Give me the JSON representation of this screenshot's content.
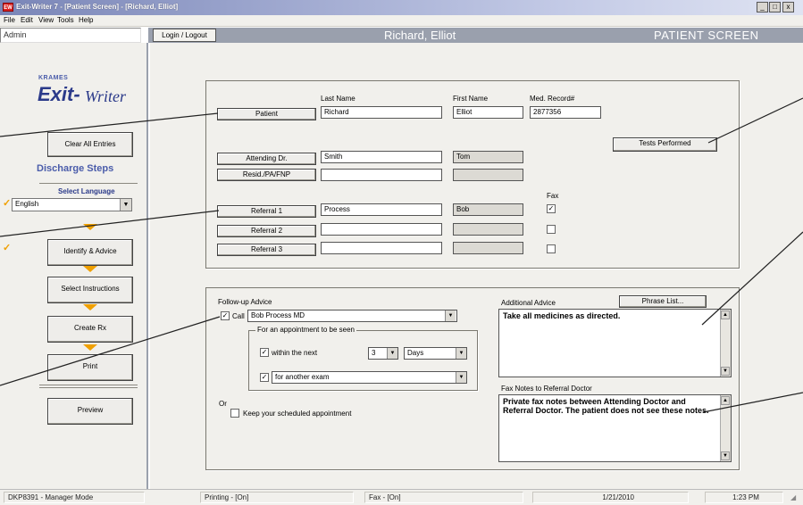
{
  "window": {
    "icon_text": "EW",
    "title": "Exit-Writer 7 - [Patient Screen] - [Richard, Elliot]",
    "minimize": "_",
    "maximize": "□",
    "close": "x"
  },
  "menu": [
    "File",
    "Edit",
    "View",
    "Tools",
    "Help"
  ],
  "header": {
    "user": "Admin",
    "login_label": "Login / Logout",
    "patient_name": "Richard, Elliot",
    "screen_title": "PATIENT SCREEN"
  },
  "sidebar": {
    "logo_brand": "KRAMES",
    "logo_exit": "Exit-",
    "logo_writer": "Writer",
    "clear_all": "Clear All Entries",
    "discharge_steps": "Discharge Steps",
    "select_language": "Select Language",
    "language": "English",
    "identify": "Identify & Advice",
    "select_instructions": "Select Instructions",
    "create_rx": "Create Rx",
    "print": "Print",
    "preview": "Preview"
  },
  "patient": {
    "last_name_label": "Last Name",
    "first_name_label": "First Name",
    "mrn_label": "Med. Record#",
    "patient_button": "Patient",
    "last_name": "Richard",
    "first_name": "Elliot",
    "mrn": "2877356",
    "tests_button": "Tests Performed",
    "attending_button": "Attending Dr.",
    "attending_last": "Smith",
    "attending_first": "Tom",
    "resid_button": "Resid./PA/FNP",
    "fax_label": "Fax",
    "referral1_button": "Referral 1",
    "referral1_last": "Process",
    "referral1_first": "Bob",
    "referral1_fax": "✓",
    "referral2_button": "Referral 2",
    "referral3_button": "Referral 3"
  },
  "followup": {
    "label": "Follow-up Advice",
    "call_checked": "✓",
    "call_label": "Call",
    "call_value": "Bob Process MD",
    "appointment_group": "For an appointment to be seen",
    "within_checked": "✓",
    "within_label": "within the next",
    "within_number": "3",
    "within_unit": "Days",
    "another_checked": "✓",
    "another_value": "for another exam",
    "or_label": "Or",
    "keep_label": "Keep your scheduled appointment"
  },
  "advice": {
    "additional_label": "Additional Advice",
    "phrase_button": "Phrase List...",
    "additional_text": "Take all medicines as directed.",
    "faxnotes_label": "Fax Notes to Referral Doctor",
    "faxnotes_text": "Private fax notes between Attending Doctor and Referral Doctor. The patient does not see these notes."
  },
  "status": {
    "mode": "DKP8391 - Manager Mode",
    "printing": "Printing - [On]",
    "fax": "Fax - [On]",
    "date": "1/21/2010",
    "time": "1:23 PM"
  }
}
